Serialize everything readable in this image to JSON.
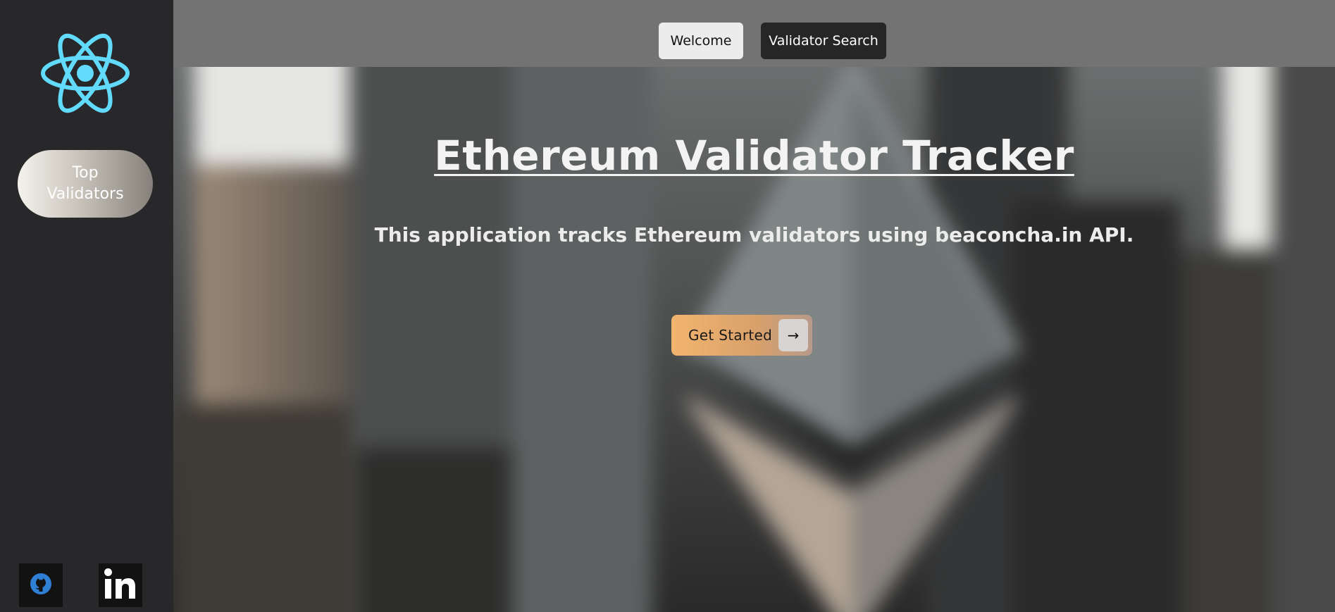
{
  "sidebar": {
    "logo_icon": "react-atom-icon",
    "logo_color": "#61dafb",
    "top_validators_label": "Top Validators",
    "social": [
      {
        "icon": "github-icon",
        "color": "#2f7fd4"
      },
      {
        "icon": "linkedin-icon",
        "color": "#ffffff"
      }
    ]
  },
  "topbar": {
    "tabs": [
      {
        "label": "Welcome",
        "active": true
      },
      {
        "label": "Validator Search",
        "active": false
      }
    ]
  },
  "hero": {
    "title": "Ethereum Validator Tracker",
    "subtitle": "This application tracks Ethereum validators using beaconcha.in API.",
    "cta_label": "Get Started",
    "cta_icon": "arrow-right-icon",
    "cta_arrow_glyph": "→",
    "background_icon": "ethereum-logo-icon"
  },
  "colors": {
    "sidebar_bg": "#28282a",
    "topbar_bg": "#737373",
    "cta_accent": "#f2b46e"
  }
}
